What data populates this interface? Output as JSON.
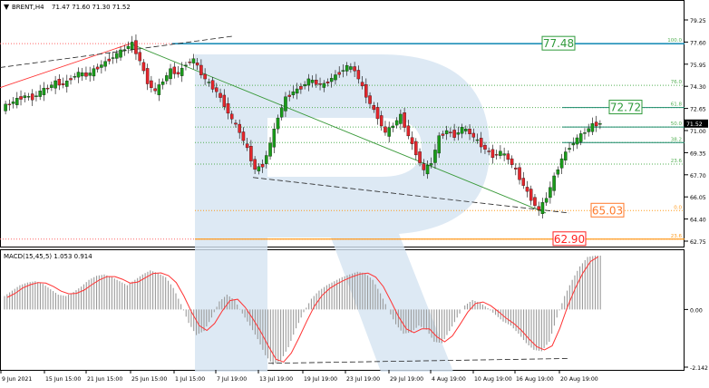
{
  "header": {
    "symbol_label": "BRENT,H4",
    "ohlc": "71.47 71.60 71.30 71.52"
  },
  "macd_header": "MACD(15,45,5) 1.053 0.914",
  "colors": {
    "bull": "#1a9b1a",
    "bear": "#e3262c",
    "resistance_line": "#1f8fb8",
    "fib_green": "#55b055",
    "fib_orange": "#ff9b1c",
    "fib_red": "#ff6666",
    "target_green": "#2e9a3a",
    "target_orange": "#ff7a2a",
    "target_red": "#ff2222",
    "macd_signal": "#ff3333",
    "macd_hist": "#9a9a9a",
    "watermark": "#d4e3f1"
  },
  "chart_data": [
    {
      "type": "candlestick",
      "title": "BRENT,H4",
      "ylim": [
        62.75,
        79.25
      ],
      "y_ticks": [
        "79.25",
        "77.60",
        "75.95",
        "74.30",
        "72.65",
        "71.00",
        "69.35",
        "67.70",
        "66.05",
        "64.40",
        "62.75"
      ],
      "current_price": "71.52",
      "x_ticks": [
        "9 Jun 2021",
        "15 Jun 15:00",
        "21 Jun 15:00",
        "25 Jun 15:00",
        "1 Jul 15:00",
        "7 Jul 19:00",
        "13 Jul 19:00",
        "19 Jul 19:00",
        "23 Jul 19:00",
        "29 Jul 19:00",
        "4 Aug 19:00",
        "10 Aug 19:00",
        "16 Aug 19:00",
        "20 Aug 19:00"
      ],
      "close_path": [
        73.0,
        73.3,
        73.6,
        73.4,
        73.9,
        74.2,
        74.6,
        74.4,
        74.9,
        75.3,
        75.1,
        75.5,
        75.9,
        76.3,
        76.7,
        77.1,
        77.48,
        76.2,
        74.6,
        73.9,
        74.7,
        75.5,
        75.2,
        76.0,
        76.3,
        75.2,
        74.5,
        73.9,
        72.9,
        71.8,
        70.9,
        69.6,
        68.1,
        68.4,
        70.0,
        72.0,
        73.4,
        73.9,
        74.2,
        74.8,
        74.5,
        74.4,
        74.9,
        75.3,
        75.8,
        75.5,
        74.2,
        73.0,
        72.0,
        70.8,
        71.4,
        72.1,
        70.6,
        69.3,
        68.0,
        68.6,
        70.5,
        71.0,
        70.6,
        71.2,
        70.8,
        70.2,
        69.6,
        69.1,
        69.4,
        68.9,
        68.0,
        66.9,
        65.9,
        65.03,
        66.0,
        67.5,
        68.9,
        69.8,
        70.4,
        70.9,
        71.4,
        71.52
      ],
      "levels": [
        {
          "label": "100.0",
          "value": 77.48
        },
        {
          "label": "76.0",
          "value": 74.37
        },
        {
          "label": "61.8",
          "value": 72.72
        },
        {
          "label": "50.0",
          "value": 71.26
        },
        {
          "label": "38.2",
          "value": 70.1
        },
        {
          "label": "23.6",
          "value": 68.5
        },
        {
          "label": "0.0",
          "value": 65.03
        },
        {
          "label": "23.6",
          "value": 62.9
        }
      ],
      "targets": [
        {
          "label": "77.48",
          "value": 77.48
        },
        {
          "label": "72.72",
          "value": 72.72
        },
        {
          "label": "65.03",
          "value": 65.03
        },
        {
          "label": "62.90",
          "value": 62.9
        }
      ]
    },
    {
      "type": "bar",
      "title": "MACD(15,45,5) 1.053 0.914",
      "ylim": [
        -2.142,
        2.0
      ],
      "y_ticks": [
        "0.00",
        "-2.142"
      ],
      "histogram": [
        0.5,
        0.7,
        0.9,
        1.0,
        1.05,
        0.95,
        0.75,
        0.55,
        0.5,
        0.65,
        0.85,
        1.1,
        1.25,
        1.3,
        1.2,
        1.05,
        0.9,
        1.1,
        1.3,
        1.45,
        1.35,
        1.2,
        0.8,
        0.2,
        -0.5,
        -0.95,
        -0.8,
        -0.3,
        0.3,
        0.55,
        0.35,
        -0.15,
        -0.6,
        -1.1,
        -1.7,
        -2.05,
        -1.9,
        -1.4,
        -0.7,
        -0.1,
        0.4,
        0.7,
        0.9,
        1.05,
        1.2,
        1.3,
        1.4,
        1.35,
        1.1,
        0.6,
        0.0,
        -0.55,
        -0.9,
        -0.85,
        -0.6,
        -0.75,
        -1.2,
        -1.25,
        -0.8,
        -0.3,
        0.15,
        0.35,
        0.25,
        0.05,
        -0.2,
        -0.45,
        -0.6,
        -0.9,
        -1.25,
        -1.5,
        -1.55,
        -1.2,
        -0.3,
        0.5,
        1.1,
        1.6,
        1.95,
        2.0
      ],
      "signal": [
        0.45,
        0.6,
        0.8,
        0.92,
        1.0,
        0.98,
        0.85,
        0.68,
        0.58,
        0.6,
        0.72,
        0.92,
        1.1,
        1.22,
        1.22,
        1.12,
        0.98,
        1.02,
        1.18,
        1.34,
        1.36,
        1.26,
        1.0,
        0.5,
        -0.1,
        -0.6,
        -0.78,
        -0.52,
        -0.05,
        0.33,
        0.38,
        0.08,
        -0.35,
        -0.82,
        -1.35,
        -1.85,
        -1.95,
        -1.62,
        -1.05,
        -0.45,
        0.12,
        0.52,
        0.78,
        0.96,
        1.1,
        1.22,
        1.32,
        1.35,
        1.2,
        0.85,
        0.3,
        -0.28,
        -0.72,
        -0.86,
        -0.72,
        -0.72,
        -1.02,
        -1.2,
        -0.98,
        -0.55,
        -0.1,
        0.22,
        0.28,
        0.14,
        -0.08,
        -0.32,
        -0.52,
        -0.78,
        -1.1,
        -1.38,
        -1.5,
        -1.35,
        -0.7,
        0.1,
        0.78,
        1.35,
        1.78,
        1.96
      ]
    }
  ]
}
